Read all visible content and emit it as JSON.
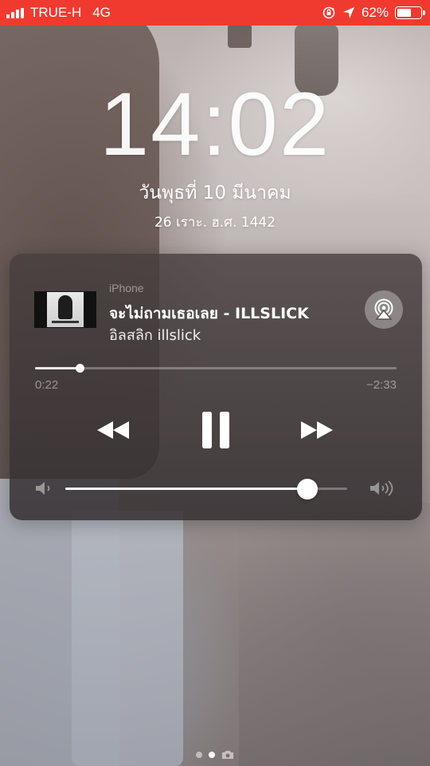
{
  "status_bar": {
    "carrier": "TRUE-H",
    "network": "4G",
    "battery_percent": "62%",
    "battery_level": 0.62,
    "background_color": "#f03a30",
    "icons": [
      "signal-bars-icon",
      "orientation-lock-icon",
      "location-arrow-icon",
      "battery-icon"
    ]
  },
  "lock_screen": {
    "time": "14:02",
    "date": "วันพุธที่ 10 มีนาคม",
    "lunar_date": "26 เราะ. ฮ.ศ. 1442"
  },
  "now_playing": {
    "source": "iPhone",
    "title": "จะไม่ถามเธอเลย - ILLSLICK",
    "artist": "อิลสลิก illslick",
    "elapsed": "0:22",
    "remaining": "−2:33",
    "progress": 0.124,
    "volume": 0.86,
    "icons": {
      "airplay": "airplay-icon",
      "rewind": "rewind-icon",
      "pause": "pause-icon",
      "fast_forward": "fast-forward-icon",
      "volume_low": "volume-low-icon",
      "volume_high": "volume-high-icon"
    }
  },
  "page_indicator": {
    "count": 2,
    "active_index": 1,
    "trailing_icon": "camera-icon"
  }
}
